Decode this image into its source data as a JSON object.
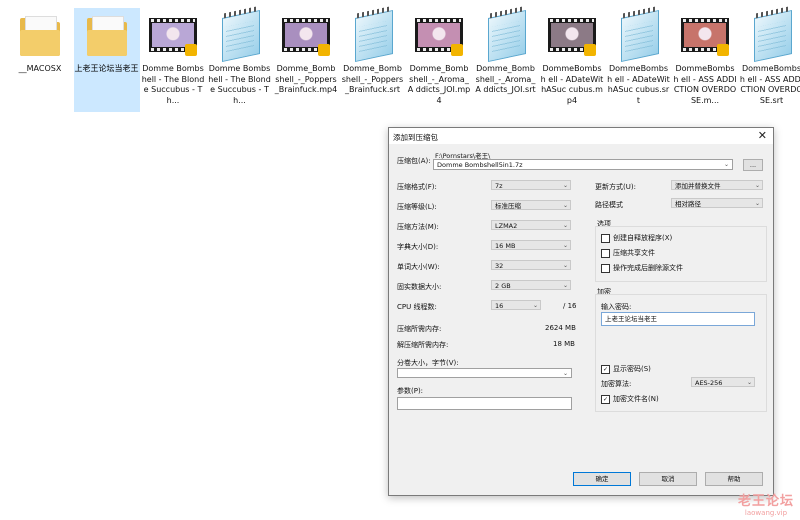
{
  "files": [
    {
      "name": "__MACOSX",
      "type": "folder",
      "selected": false
    },
    {
      "name": "上老王论坛当老王",
      "type": "folder",
      "selected": true
    },
    {
      "name": "Domme Bombshell - The Blonde Succubus - Th...",
      "type": "video",
      "thumb": "#b9a7d6"
    },
    {
      "name": "Domme Bombshell - The Blonde Succubus - Th...",
      "type": "text"
    },
    {
      "name": "Domme_Bomb shell_-_Poppers _Brainfuck.mp4",
      "type": "video",
      "thumb": "#a98fbf"
    },
    {
      "name": "Domme_Bomb shell_-_Poppers _Brainfuck.srt",
      "type": "text"
    },
    {
      "name": "Domme_Bomb shell_-_Aroma_A ddicts_JOI.mp4",
      "type": "video",
      "thumb": "#c48fb2"
    },
    {
      "name": "Domme_Bomb shell_-_Aroma_A ddicts_JOI.srt",
      "type": "text"
    },
    {
      "name": "DommeBombsh ell - ADateWithASuc cubus.mp4",
      "type": "video",
      "thumb": "#8c7a86"
    },
    {
      "name": "DommeBombsh ell - ADateWithASuc cubus.srt",
      "type": "text"
    },
    {
      "name": "DommeBombsh ell - ASS ADDICTION OVERDOSE.m...",
      "type": "video",
      "thumb": "#c7746b"
    },
    {
      "name": "DommeBombsh ell - ASS ADDICTION OVERDOSE.srt",
      "type": "text"
    }
  ],
  "dialog": {
    "title": "添加到压缩包",
    "close": "✕",
    "archive_label": "压缩包(A):",
    "archive_path": "F:\\Pornstars\\老王\\",
    "archive_name": "Domme Bombshell5in1.7z",
    "browse_label": "...",
    "format_label": "压缩格式(F):",
    "format_value": "7z",
    "level_label": "压缩等级(L):",
    "level_value": "标准压缩",
    "method_label": "压缩方法(M):",
    "method_value": "LZMA2",
    "dict_label": "字典大小(D):",
    "dict_value": "16 MB",
    "word_label": "单词大小(W):",
    "word_value": "32",
    "solid_label": "固实数据大小:",
    "solid_value": "2 GB",
    "cpu_label": "CPU 线程数:",
    "cpu_value": "16",
    "cpu_total": "/ 16",
    "mem_compress_label": "压缩所需内存:",
    "mem_compress_value": "2624 MB",
    "mem_decompress_label": "解压缩所需内存:",
    "mem_decompress_value": "18 MB",
    "split_label": "分卷大小，字节(V):",
    "params_label": "参数(P):",
    "update_label": "更新方式(U):",
    "update_value": "添加并替换文件",
    "pathmode_label": "路径模式",
    "pathmode_value": "相对路径",
    "options_title": "选项",
    "opt_sfx": "创建自释放程序(X)",
    "opt_shared": "压缩共享文件",
    "opt_delete": "操作完成后删除源文件",
    "encrypt_title": "加密",
    "password_label": "输入密码:",
    "password_value": "上老王论坛当老王",
    "show_password": "显示密码(S)",
    "enc_method_label": "加密算法:",
    "enc_method_value": "AES-256",
    "encrypt_names": "加密文件名(N)",
    "ok": "确定",
    "cancel": "取消",
    "help": "帮助"
  },
  "watermark": {
    "line1": "老王论坛",
    "line2": "laowang.vip"
  }
}
